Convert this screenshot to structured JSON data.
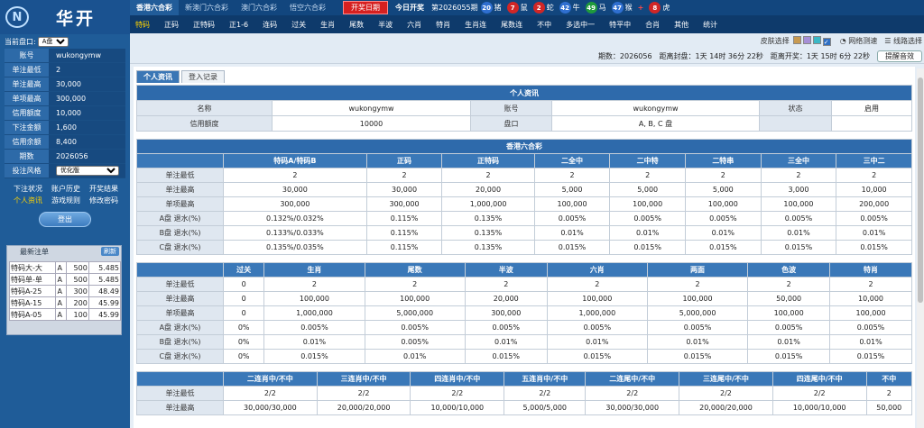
{
  "sidebar": {
    "logo_text": "华开",
    "plate_label": "当前盘口:",
    "plate_value": "A盘",
    "rows": [
      {
        "k": "账号",
        "v": "wukongymw"
      },
      {
        "k": "单注最低",
        "v": "2"
      },
      {
        "k": "单注最高",
        "v": "30,000"
      },
      {
        "k": "单项最高",
        "v": "300,000"
      },
      {
        "k": "信用额度",
        "v": "10,000"
      },
      {
        "k": "下注金额",
        "v": "1,600"
      },
      {
        "k": "信用余额",
        "v": "8,400"
      },
      {
        "k": "期数",
        "v": "2026056"
      }
    ],
    "style_label": "投注风格",
    "style_value": "优化版",
    "links": [
      "下注状况",
      "账户历史",
      "开奖结果",
      "个人资讯",
      "游戏规则",
      "修改密码"
    ],
    "logout": "登出",
    "recent_title": "最新注单",
    "refresh": "刷新",
    "recent": [
      [
        "特码大-大",
        "A",
        "500",
        "5.485"
      ],
      [
        "特码单-单",
        "A",
        "500",
        "5.485"
      ],
      [
        "特码A-25",
        "A",
        "300",
        "48.49"
      ],
      [
        "特码A-15",
        "A",
        "200",
        "45.99"
      ],
      [
        "特码A-05",
        "A",
        "100",
        "45.99"
      ]
    ]
  },
  "topbar": {
    "lotteries": [
      "香港六合彩",
      "新澳门六合彩",
      "澳门六合彩",
      "悟空六合彩"
    ],
    "draw_btn": "开奖日期",
    "today": "今日开奖",
    "issue": "第2026055期",
    "balls": [
      {
        "n": "20",
        "z": "猪",
        "c": "b"
      },
      {
        "n": "7",
        "z": "鼠",
        "c": "r"
      },
      {
        "n": "2",
        "z": "蛇",
        "c": "r"
      },
      {
        "n": "42",
        "z": "牛",
        "c": "b"
      },
      {
        "n": "49",
        "z": "马",
        "c": "g"
      },
      {
        "n": "47",
        "z": "猴",
        "c": "b"
      }
    ],
    "special": {
      "n": "8",
      "z": "虎",
      "c": "r"
    }
  },
  "nav": [
    "特码",
    "正码",
    "正特码",
    "正1-6",
    "连码",
    "过关",
    "生肖",
    "尾数",
    "半波",
    "六肖",
    "特肖",
    "生肖连",
    "尾数连",
    "不中",
    "多选中一",
    "特平中",
    "合肖",
    "其他",
    "统计"
  ],
  "toolbar": {
    "skin": "皮肤选择",
    "swatches": [
      "#c79a52",
      "#a68fd6",
      "#3bb8c6",
      "#2f6fc3"
    ],
    "net": "网络测速",
    "line": "线路选择"
  },
  "infobar": {
    "period": "期数：2026056",
    "close": "距离封盘：1天 14时 36分 22秒",
    "open": "距离开奖：1天 15时 6分 22秒",
    "sound": "提醒音效"
  },
  "tabs": [
    "个人资讯",
    "登入记录"
  ],
  "profile": {
    "title": "个人资讯",
    "name_k": "名称",
    "name_v": "wukongymw",
    "acct_k": "账号",
    "acct_v": "wukongymw",
    "status_k": "状态",
    "status_v": "启用",
    "credit_k": "信用额度",
    "credit_v": "10000",
    "plate_k": "盘口",
    "plate_v": "A, B, C 盘"
  },
  "limits_title": "香港六合彩",
  "limit_tables": [
    {
      "cols": [
        "特码A/特码B",
        "正码",
        "正特码",
        "二全中",
        "二中特",
        "二特串",
        "三全中",
        "三中二"
      ],
      "rows": [
        {
          "label": "单注最低",
          "vals": [
            "2",
            "2",
            "2",
            "2",
            "2",
            "2",
            "2",
            "2"
          ]
        },
        {
          "label": "单注最高",
          "vals": [
            "30,000",
            "30,000",
            "20,000",
            "5,000",
            "5,000",
            "5,000",
            "3,000",
            "10,000"
          ]
        },
        {
          "label": "单项最高",
          "vals": [
            "300,000",
            "300,000",
            "1,000,000",
            "100,000",
            "100,000",
            "100,000",
            "100,000",
            "200,000"
          ]
        },
        {
          "label": "A盘 退水(%)",
          "vals": [
            "0.132%/0.032%",
            "0.115%",
            "0.135%",
            "0.005%",
            "0.005%",
            "0.005%",
            "0.005%",
            "0.005%"
          ]
        },
        {
          "label": "B盘 退水(%)",
          "vals": [
            "0.133%/0.033%",
            "0.115%",
            "0.135%",
            "0.01%",
            "0.01%",
            "0.01%",
            "0.01%",
            "0.01%"
          ]
        },
        {
          "label": "C盘 退水(%)",
          "vals": [
            "0.135%/0.035%",
            "0.115%",
            "0.135%",
            "0.015%",
            "0.015%",
            "0.015%",
            "0.015%",
            "0.015%"
          ]
        }
      ]
    },
    {
      "cols": [
        "过关",
        "生肖",
        "尾数",
        "半波",
        "六肖",
        "两面",
        "色波",
        "特肖"
      ],
      "rows": [
        {
          "label": "单注最低",
          "vals": [
            "0",
            "2",
            "2",
            "2",
            "2",
            "2",
            "2",
            "2"
          ]
        },
        {
          "label": "单注最高",
          "vals": [
            "0",
            "100,000",
            "100,000",
            "20,000",
            "100,000",
            "100,000",
            "50,000",
            "10,000"
          ]
        },
        {
          "label": "单项最高",
          "vals": [
            "0",
            "1,000,000",
            "5,000,000",
            "300,000",
            "1,000,000",
            "5,000,000",
            "100,000",
            "100,000"
          ]
        },
        {
          "label": "A盘 退水(%)",
          "vals": [
            "0%",
            "0.005%",
            "0.005%",
            "0.005%",
            "0.005%",
            "0.005%",
            "0.005%",
            "0.005%"
          ]
        },
        {
          "label": "B盘 退水(%)",
          "vals": [
            "0%",
            "0.01%",
            "0.005%",
            "0.01%",
            "0.01%",
            "0.01%",
            "0.01%",
            "0.01%"
          ]
        },
        {
          "label": "C盘 退水(%)",
          "vals": [
            "0%",
            "0.015%",
            "0.01%",
            "0.015%",
            "0.015%",
            "0.015%",
            "0.015%",
            "0.015%"
          ]
        }
      ]
    },
    {
      "cols": [
        "二连肖中/不中",
        "三连肖中/不中",
        "四连肖中/不中",
        "五连肖中/不中",
        "二连尾中/不中",
        "三连尾中/不中",
        "四连尾中/不中",
        "不中"
      ],
      "rows": [
        {
          "label": "单注最低",
          "vals": [
            "2/2",
            "2/2",
            "2/2",
            "2/2",
            "2/2",
            "2/2",
            "2/2",
            "2"
          ]
        },
        {
          "label": "单注最高",
          "vals": [
            "30,000/30,000",
            "20,000/20,000",
            "10,000/10,000",
            "5,000/5,000",
            "30,000/30,000",
            "20,000/20,000",
            "10,000/10,000",
            "50,000"
          ]
        }
      ]
    }
  ]
}
